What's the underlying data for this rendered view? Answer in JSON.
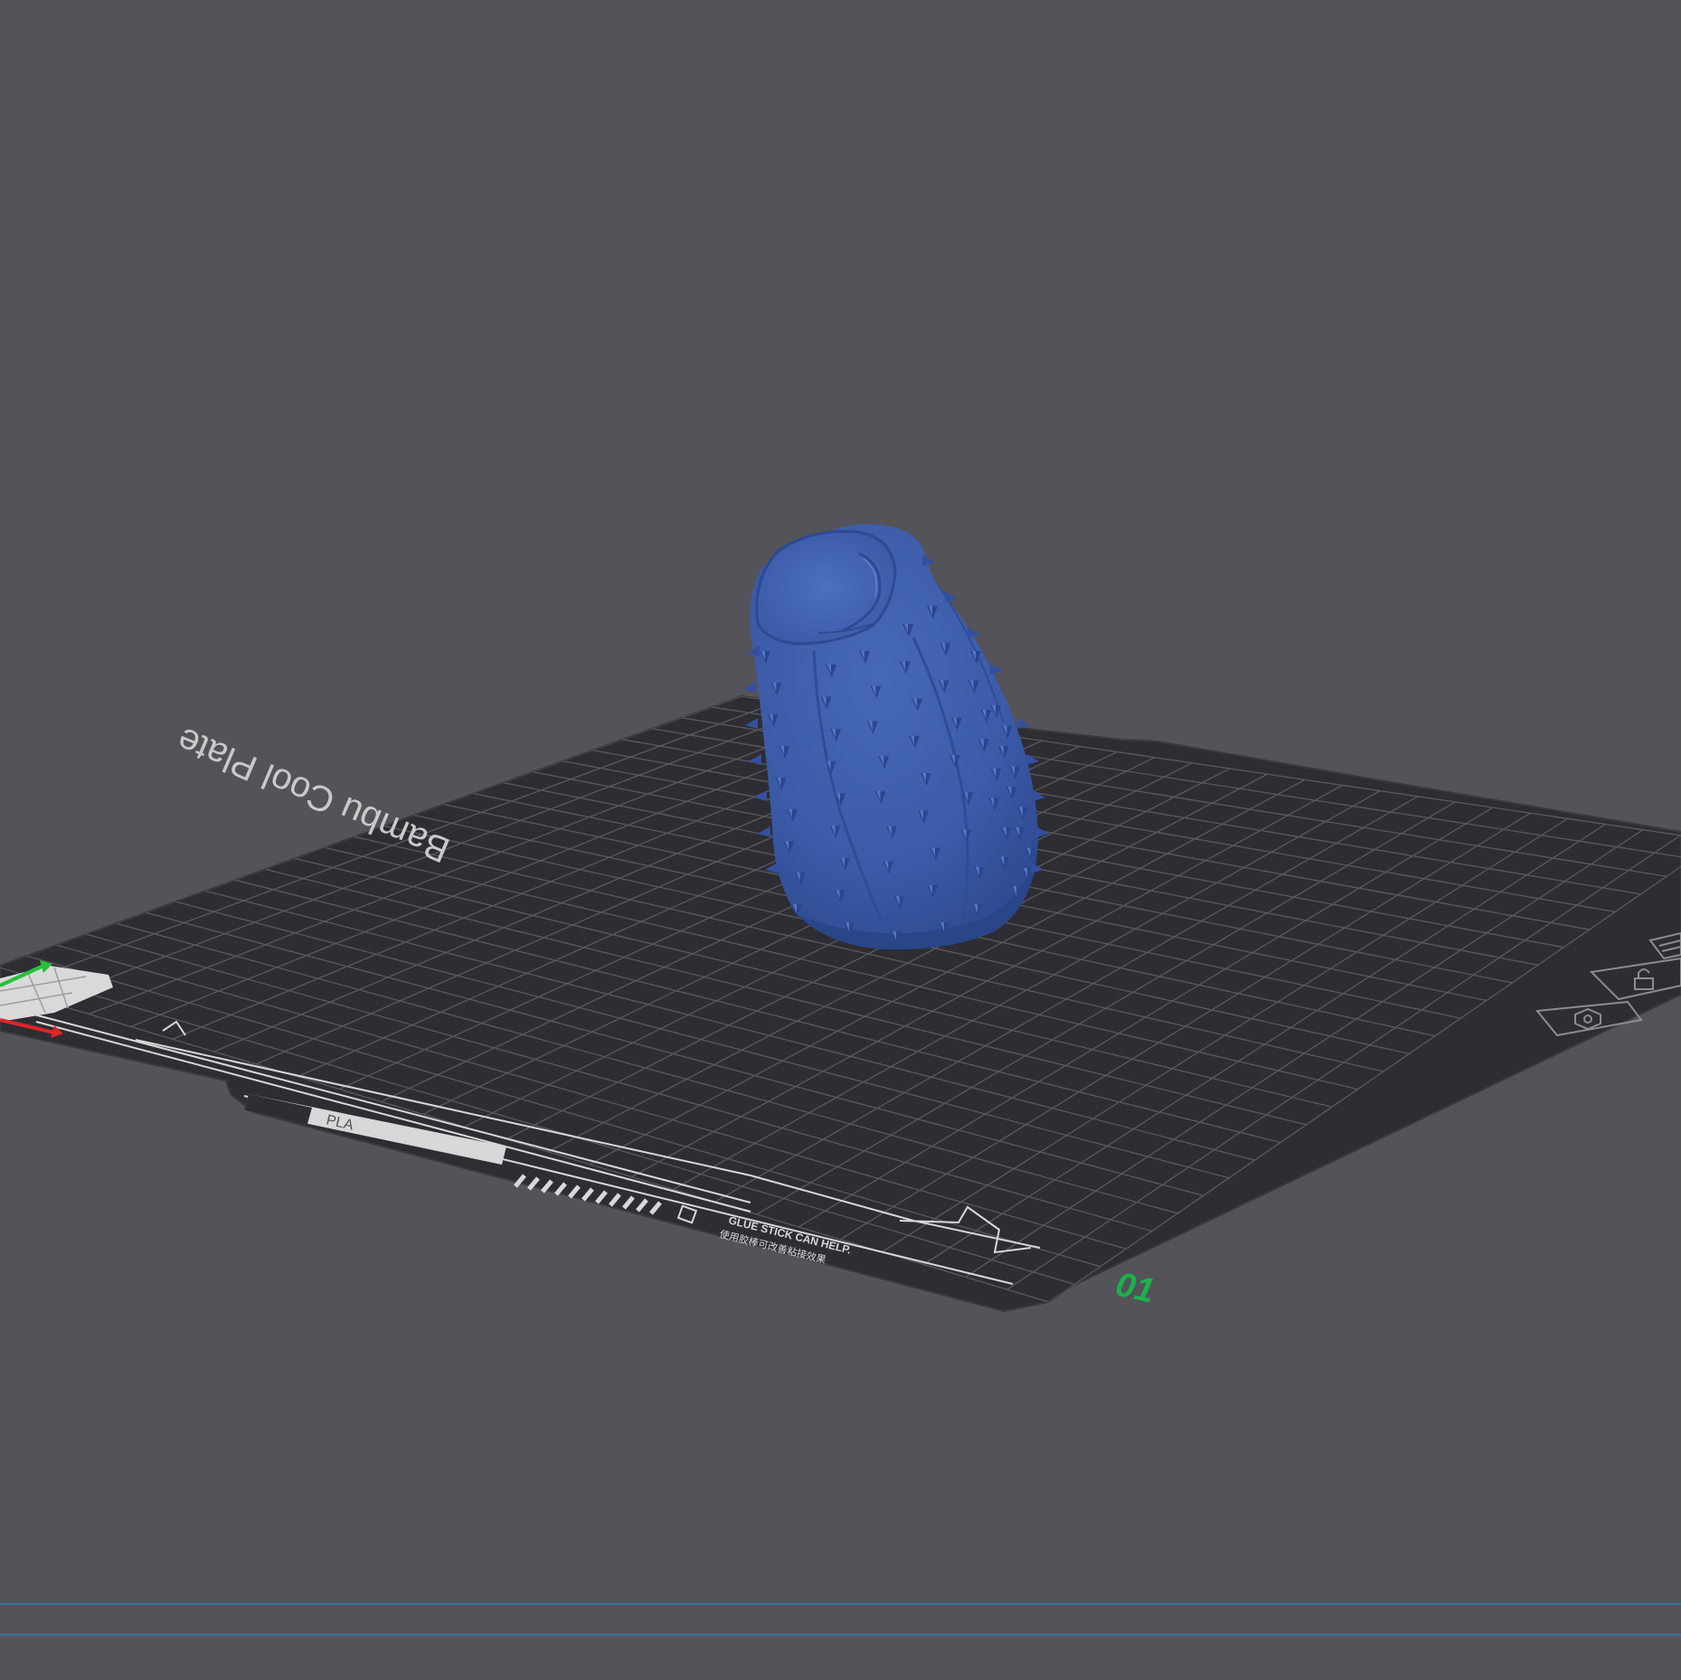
{
  "app": {
    "view": "3d-prepare-viewport"
  },
  "colors": {
    "background": "#54535a",
    "plate": "#2e2d33",
    "grid": "#5c5b63",
    "model": "#3b5ba8",
    "model_shadow": "#2a4588",
    "plate_number": "#19b34a",
    "axis_x": "#e0242a",
    "axis_y": "#23c23a",
    "guide_line": "#2f7fb0"
  },
  "plate": {
    "name_text": "Bambu Cool Plate",
    "number_text": "01",
    "material_label": "PLA",
    "hint_line_1": "GLUE STICK CAN HELP.",
    "hint_line_2": "使用胶棒可改善粘接效果"
  },
  "plate_icons": [
    "settings-hexagon-icon",
    "lock-icon",
    "arrange-icon"
  ],
  "model": {
    "type": "spiked-cylinder-object"
  }
}
